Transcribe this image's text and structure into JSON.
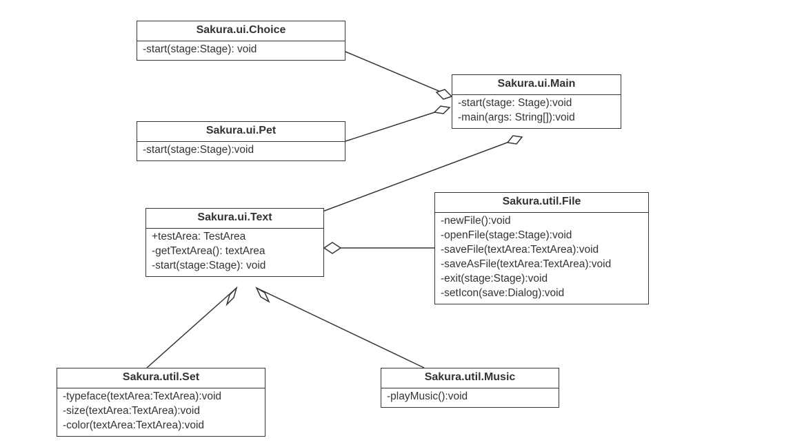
{
  "classes": {
    "choice": {
      "name": "Sakura.ui.Choice",
      "members": [
        "-start(stage:Stage): void"
      ]
    },
    "pet": {
      "name": "Sakura.ui.Pet",
      "members": [
        "-start(stage:Stage):void"
      ]
    },
    "main": {
      "name": "Sakura.ui.Main",
      "members": [
        "-start(stage: Stage):void",
        "-main(args: String[]):void"
      ]
    },
    "text": {
      "name": "Sakura.ui.Text",
      "members": [
        "+testArea: TestArea",
        "-getTextArea(): textArea",
        "-start(stage:Stage): void"
      ]
    },
    "file": {
      "name": "Sakura.util.File",
      "members": [
        "-newFile():void",
        "-openFile(stage:Stage):void",
        "-saveFile(textArea:TextArea):void",
        "-saveAsFile(textArea:TextArea):void",
        "-exit(stage:Stage):void",
        "-setIcon(save:Dialog):void"
      ]
    },
    "set": {
      "name": "Sakura.util.Set",
      "members": [
        "-typeface(textArea:TextArea):void",
        "-size(textArea:TextArea):void",
        "-color(textArea:TextArea):void"
      ]
    },
    "music": {
      "name": "Sakura.util.Music",
      "members": [
        "-playMusic():void"
      ]
    }
  },
  "relations": [
    {
      "from": "choice",
      "to": "main",
      "type": "aggregation"
    },
    {
      "from": "pet",
      "to": "main",
      "type": "aggregation"
    },
    {
      "from": "text",
      "to": "main",
      "type": "aggregation"
    },
    {
      "from": "file",
      "to": "text",
      "type": "aggregation"
    },
    {
      "from": "set",
      "to": "text",
      "type": "aggregation"
    },
    {
      "from": "music",
      "to": "text",
      "type": "aggregation"
    }
  ]
}
